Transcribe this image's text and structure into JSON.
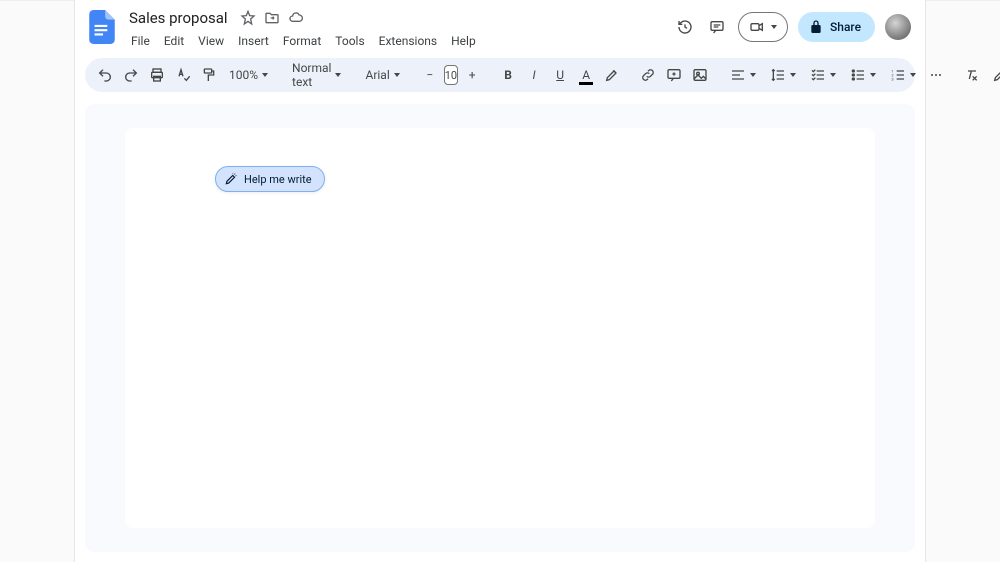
{
  "header": {
    "doc_title": "Sales proposal",
    "menu": [
      "File",
      "Edit",
      "View",
      "Insert",
      "Format",
      "Tools",
      "Extensions",
      "Help"
    ],
    "share_label": "Share"
  },
  "toolbar": {
    "zoom": "100%",
    "style": "Normal text",
    "font": "Arial",
    "font_size": "10"
  },
  "assist_chip": {
    "label": "Help me write"
  }
}
